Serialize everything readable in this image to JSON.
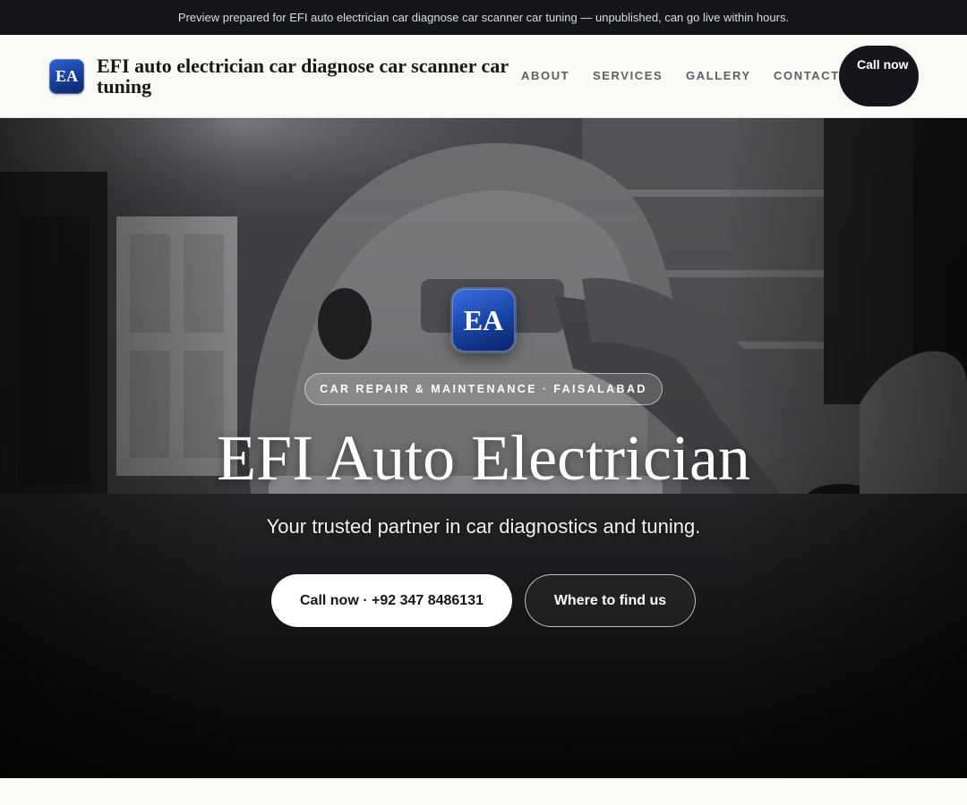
{
  "preview_banner": {
    "text": "Preview prepared for EFI auto electrician car diagnose car scanner car tuning — unpublished, can go live within hours."
  },
  "header": {
    "logo_initials": "EA",
    "brand_name": "EFI auto electrician car diagnose car scanner car tuning",
    "nav": [
      {
        "label": "ABOUT"
      },
      {
        "label": "SERVICES"
      },
      {
        "label": "GALLERY"
      },
      {
        "label": "CONTACT"
      }
    ],
    "call_button_label": "Call now"
  },
  "hero": {
    "badge_initials": "EA",
    "tagline": "CAR REPAIR & MAINTENANCE · FAISALABAD",
    "title": "EFI Auto Electrician",
    "subtitle": "Your trusted partner in car diagnostics and tuning.",
    "primary_button_label": "Call now · +92 347 8486131",
    "secondary_button_label": "Where to find us",
    "background_image": "garage-photo-grayscale"
  },
  "colors": {
    "dark": "#14161b",
    "page_bg": "#faf9f6",
    "badge_blue": "#1a46a8",
    "white": "#ffffff"
  }
}
